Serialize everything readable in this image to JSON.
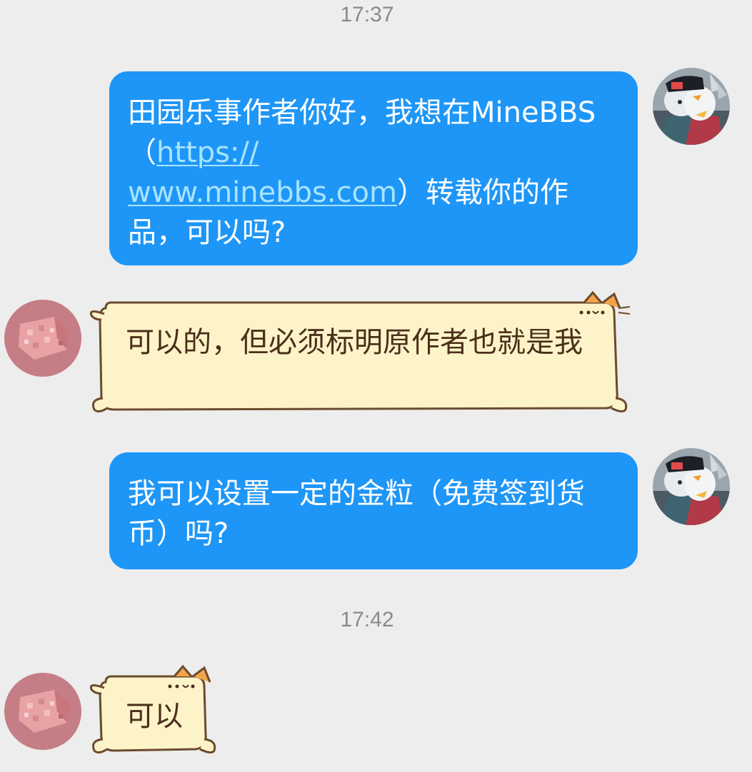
{
  "conversation": {
    "timestamps": [
      "17:37",
      "17:42"
    ],
    "messages": [
      {
        "sender": "me",
        "text_before_link": "田园乐事作者你好，我想在MineBBS（",
        "link_line1": "https://",
        "link_line2": "www.minebbs.com",
        "text_after_link": "）转载你的作品，可以吗?"
      },
      {
        "sender": "other",
        "text": "可以的，但必须标明原作者也就是我"
      },
      {
        "sender": "me",
        "text": "我可以设置一定的金粒（免费签到货币）吗?"
      },
      {
        "sender": "other",
        "text": "可以"
      }
    ]
  },
  "colors": {
    "background": "#ededed",
    "outgoing_bubble": "#1e96f7",
    "incoming_bubble": "#fdf3c9",
    "incoming_border": "#6b4b2e",
    "link": "#a8e4ff"
  },
  "icons": {
    "my_avatar": "wolf-character-avatar",
    "other_avatar": "pink-cheese-block-avatar",
    "bubble_decoration": "cat-ears-icon"
  }
}
